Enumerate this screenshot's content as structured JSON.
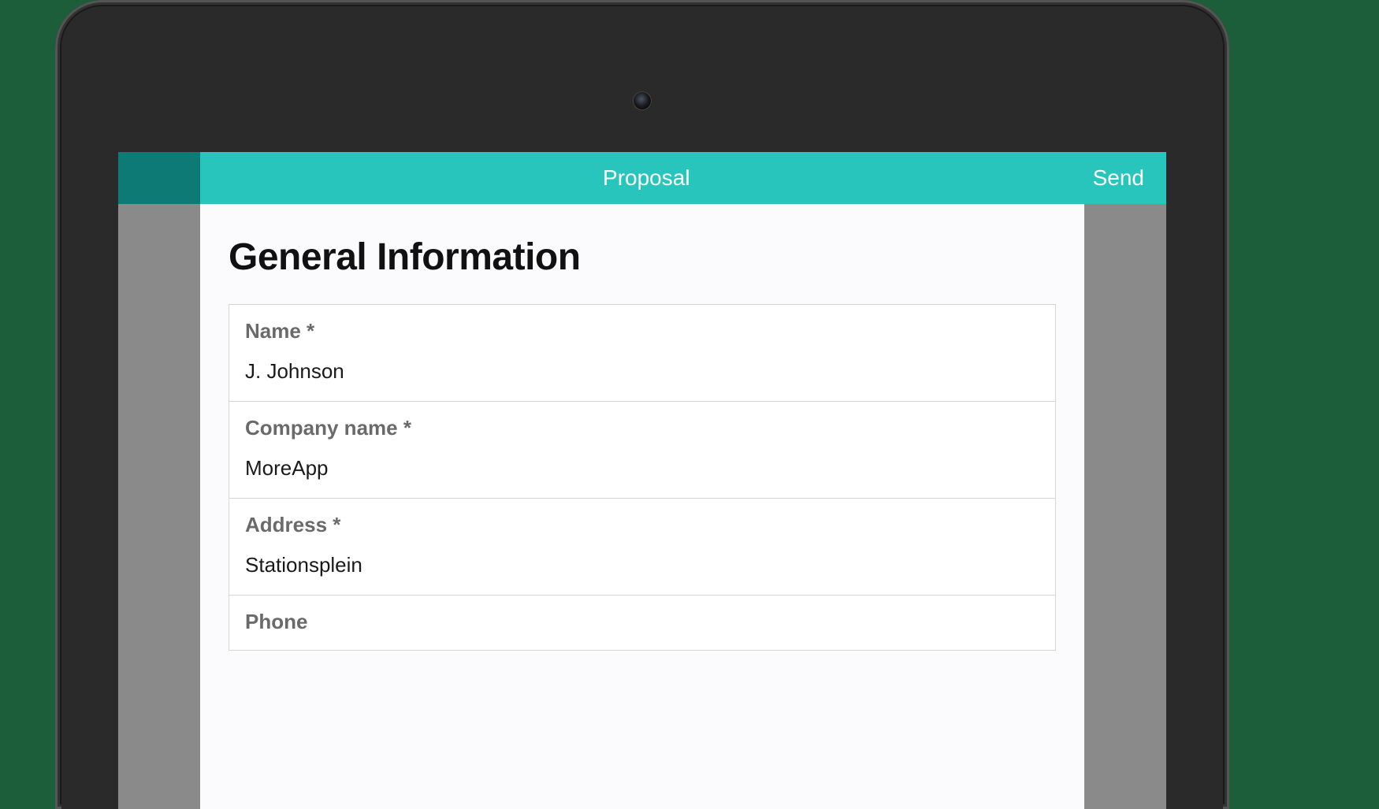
{
  "header": {
    "title": "Proposal",
    "send_label": "Send"
  },
  "section": {
    "title": "General Information"
  },
  "fields": {
    "name": {
      "label": "Name *",
      "value": "J. Johnson"
    },
    "company": {
      "label": "Company name *",
      "value": "MoreApp"
    },
    "address": {
      "label": "Address *",
      "value": "Stationsplein"
    },
    "phone": {
      "label": "Phone"
    }
  },
  "colors": {
    "accent": "#27c5bb",
    "accent_dark": "#0e7a76"
  }
}
